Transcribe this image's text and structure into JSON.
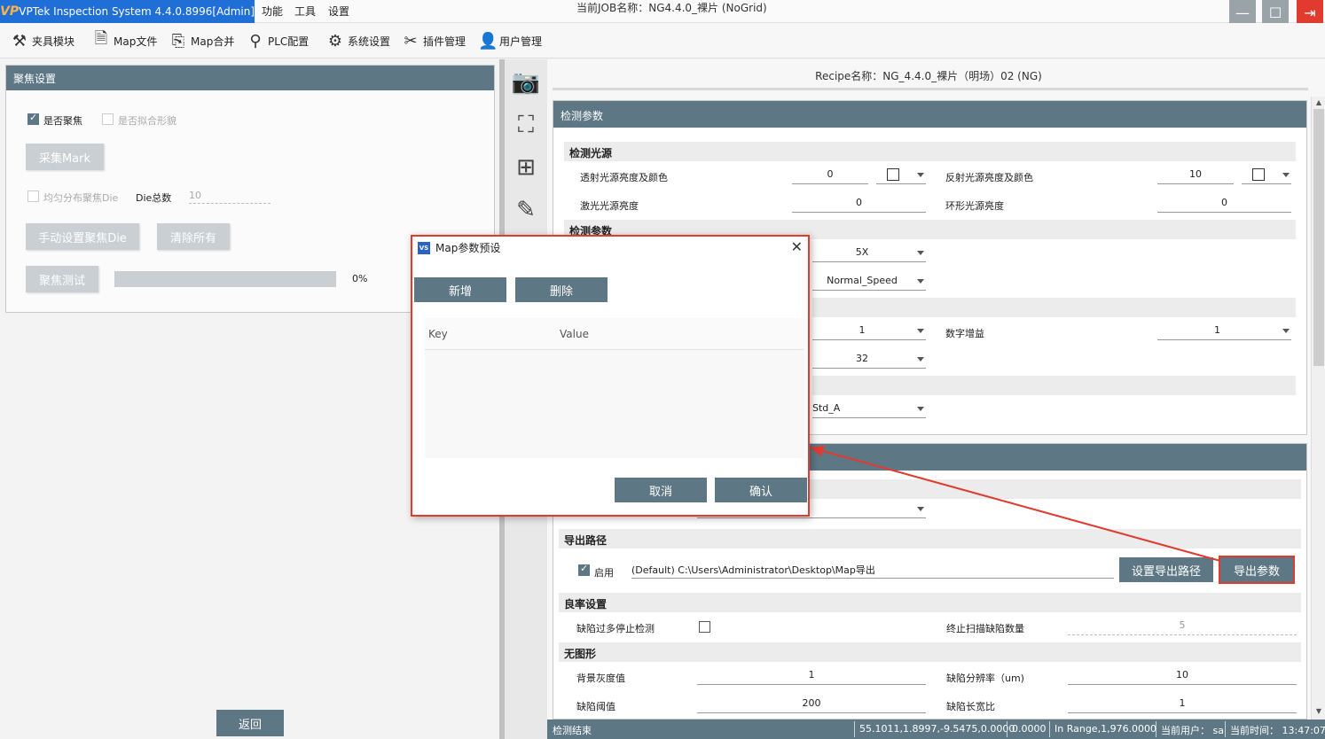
{
  "titlebar": {
    "app_title": "VPTek Inspection System 4.4.0.8996[Admin]",
    "logo": "VP",
    "menu": [
      "功能",
      "工具",
      "设置"
    ],
    "job_name": "当前JOB名称：NG4.4.0_裸片 (NoGrid)"
  },
  "window_controls": {
    "minimize": "—",
    "maximize": "☐",
    "close": "⇥"
  },
  "toolbar": {
    "items": [
      {
        "label": "夹具模块",
        "icon": "wrench-icon",
        "glyph": "⚒"
      },
      {
        "label": "Map文件",
        "icon": "file-icon",
        "glyph": "🗎"
      },
      {
        "label": "Map合并",
        "icon": "merge-icon",
        "glyph": "⎘"
      },
      {
        "label": "PLC配置",
        "icon": "plc-icon",
        "glyph": "⚲"
      },
      {
        "label": "系统设置",
        "icon": "gear-icon",
        "glyph": "⚙"
      },
      {
        "label": "插件管理",
        "icon": "tools-icon",
        "glyph": "✂"
      },
      {
        "label": "用户管理",
        "icon": "user-icon",
        "glyph": "👤"
      }
    ]
  },
  "focus_panel": {
    "title": "聚焦设置",
    "is_focus_label": "是否聚焦",
    "is_focus_checked": true,
    "fit_shape_label": "是否拟合形貌",
    "fit_shape_checked": false,
    "capture_mark": "采集Mark",
    "uniform_label": "均匀分布聚焦Die",
    "die_total_label": "Die总数",
    "die_total_value": "10",
    "manual_set_button": "手动设置聚焦Die",
    "clear_all_button": "清除所有",
    "focus_test_button": "聚焦测试",
    "progress_text": "0%",
    "progress": 1.0
  },
  "back_button": "返回",
  "side_icons": [
    "camera-icon",
    "image-fit-icon",
    "grid-list-icon",
    "ruler-icon"
  ],
  "side_glyphs": [
    "📷",
    "⛶",
    "⊞",
    "✎"
  ],
  "right": {
    "recipe": "Recipe名称：NG_4.4.0_裸片（明场）02 (NG)",
    "section1_title": "检测参数",
    "light_source_head": "检测光源",
    "transmit_label": "透射光源亮度及颜色",
    "transmit_value": "0",
    "reflect_label": "反射光源亮度及颜色",
    "reflect_value": "10",
    "laser_label": "激光光源亮度",
    "laser_value": "0",
    "ring_label": "环形光源亮度",
    "ring_value": "0",
    "detect_head": "检测参数",
    "lens_value": "5X",
    "speed_value": "Normal_Speed",
    "gain1_value": "1",
    "digital_gain_label": "数字增益",
    "digital_gain_value": "1",
    "bits_value": "32",
    "algo_value": "Std_A",
    "export_path_head": "导出路径",
    "enable_label": "启用",
    "enable_checked": true,
    "export_path": "(Default) C:\\Users\\Administrator\\Desktop\\Map导出",
    "set_export_path_button": "设置导出路径",
    "export_params_button": "导出参数",
    "yield_head": "良率设置",
    "stop_on_defects_label": "缺陷过多停止检测",
    "stop_scan_label": "终止扫描缺陷数量",
    "stop_scan_value": "5",
    "no_shape_head": "无图形",
    "bg_gray_label": "背景灰度值",
    "bg_gray_value": "1",
    "defect_res_label": "缺陷分辨率（um)",
    "defect_res_value": "10",
    "defect_thresh_label": "缺陷阈值",
    "defect_thresh_value": "200",
    "defect_ratio_label": "缺陷长宽比",
    "defect_ratio_value": "1"
  },
  "statusbar": {
    "status": "检测结束",
    "coords": "55.1011,1.8997,-9.5475,0.0000",
    "value": "0.0000",
    "range": "In Range,1,976.0000",
    "user": "当前用户： sa",
    "time": "当前时间： 13:47:07"
  },
  "dialog": {
    "title": "Map参数预设",
    "icon_text": "VS",
    "add_button": "新增",
    "delete_button": "删除",
    "col_key": "Key",
    "col_value": "Value",
    "cancel_button": "取消",
    "confirm_button": "确认"
  },
  "colors": {
    "accent": "#5e7785",
    "title_blue": "#1f6fd6",
    "highlight": "#e03b2e"
  }
}
